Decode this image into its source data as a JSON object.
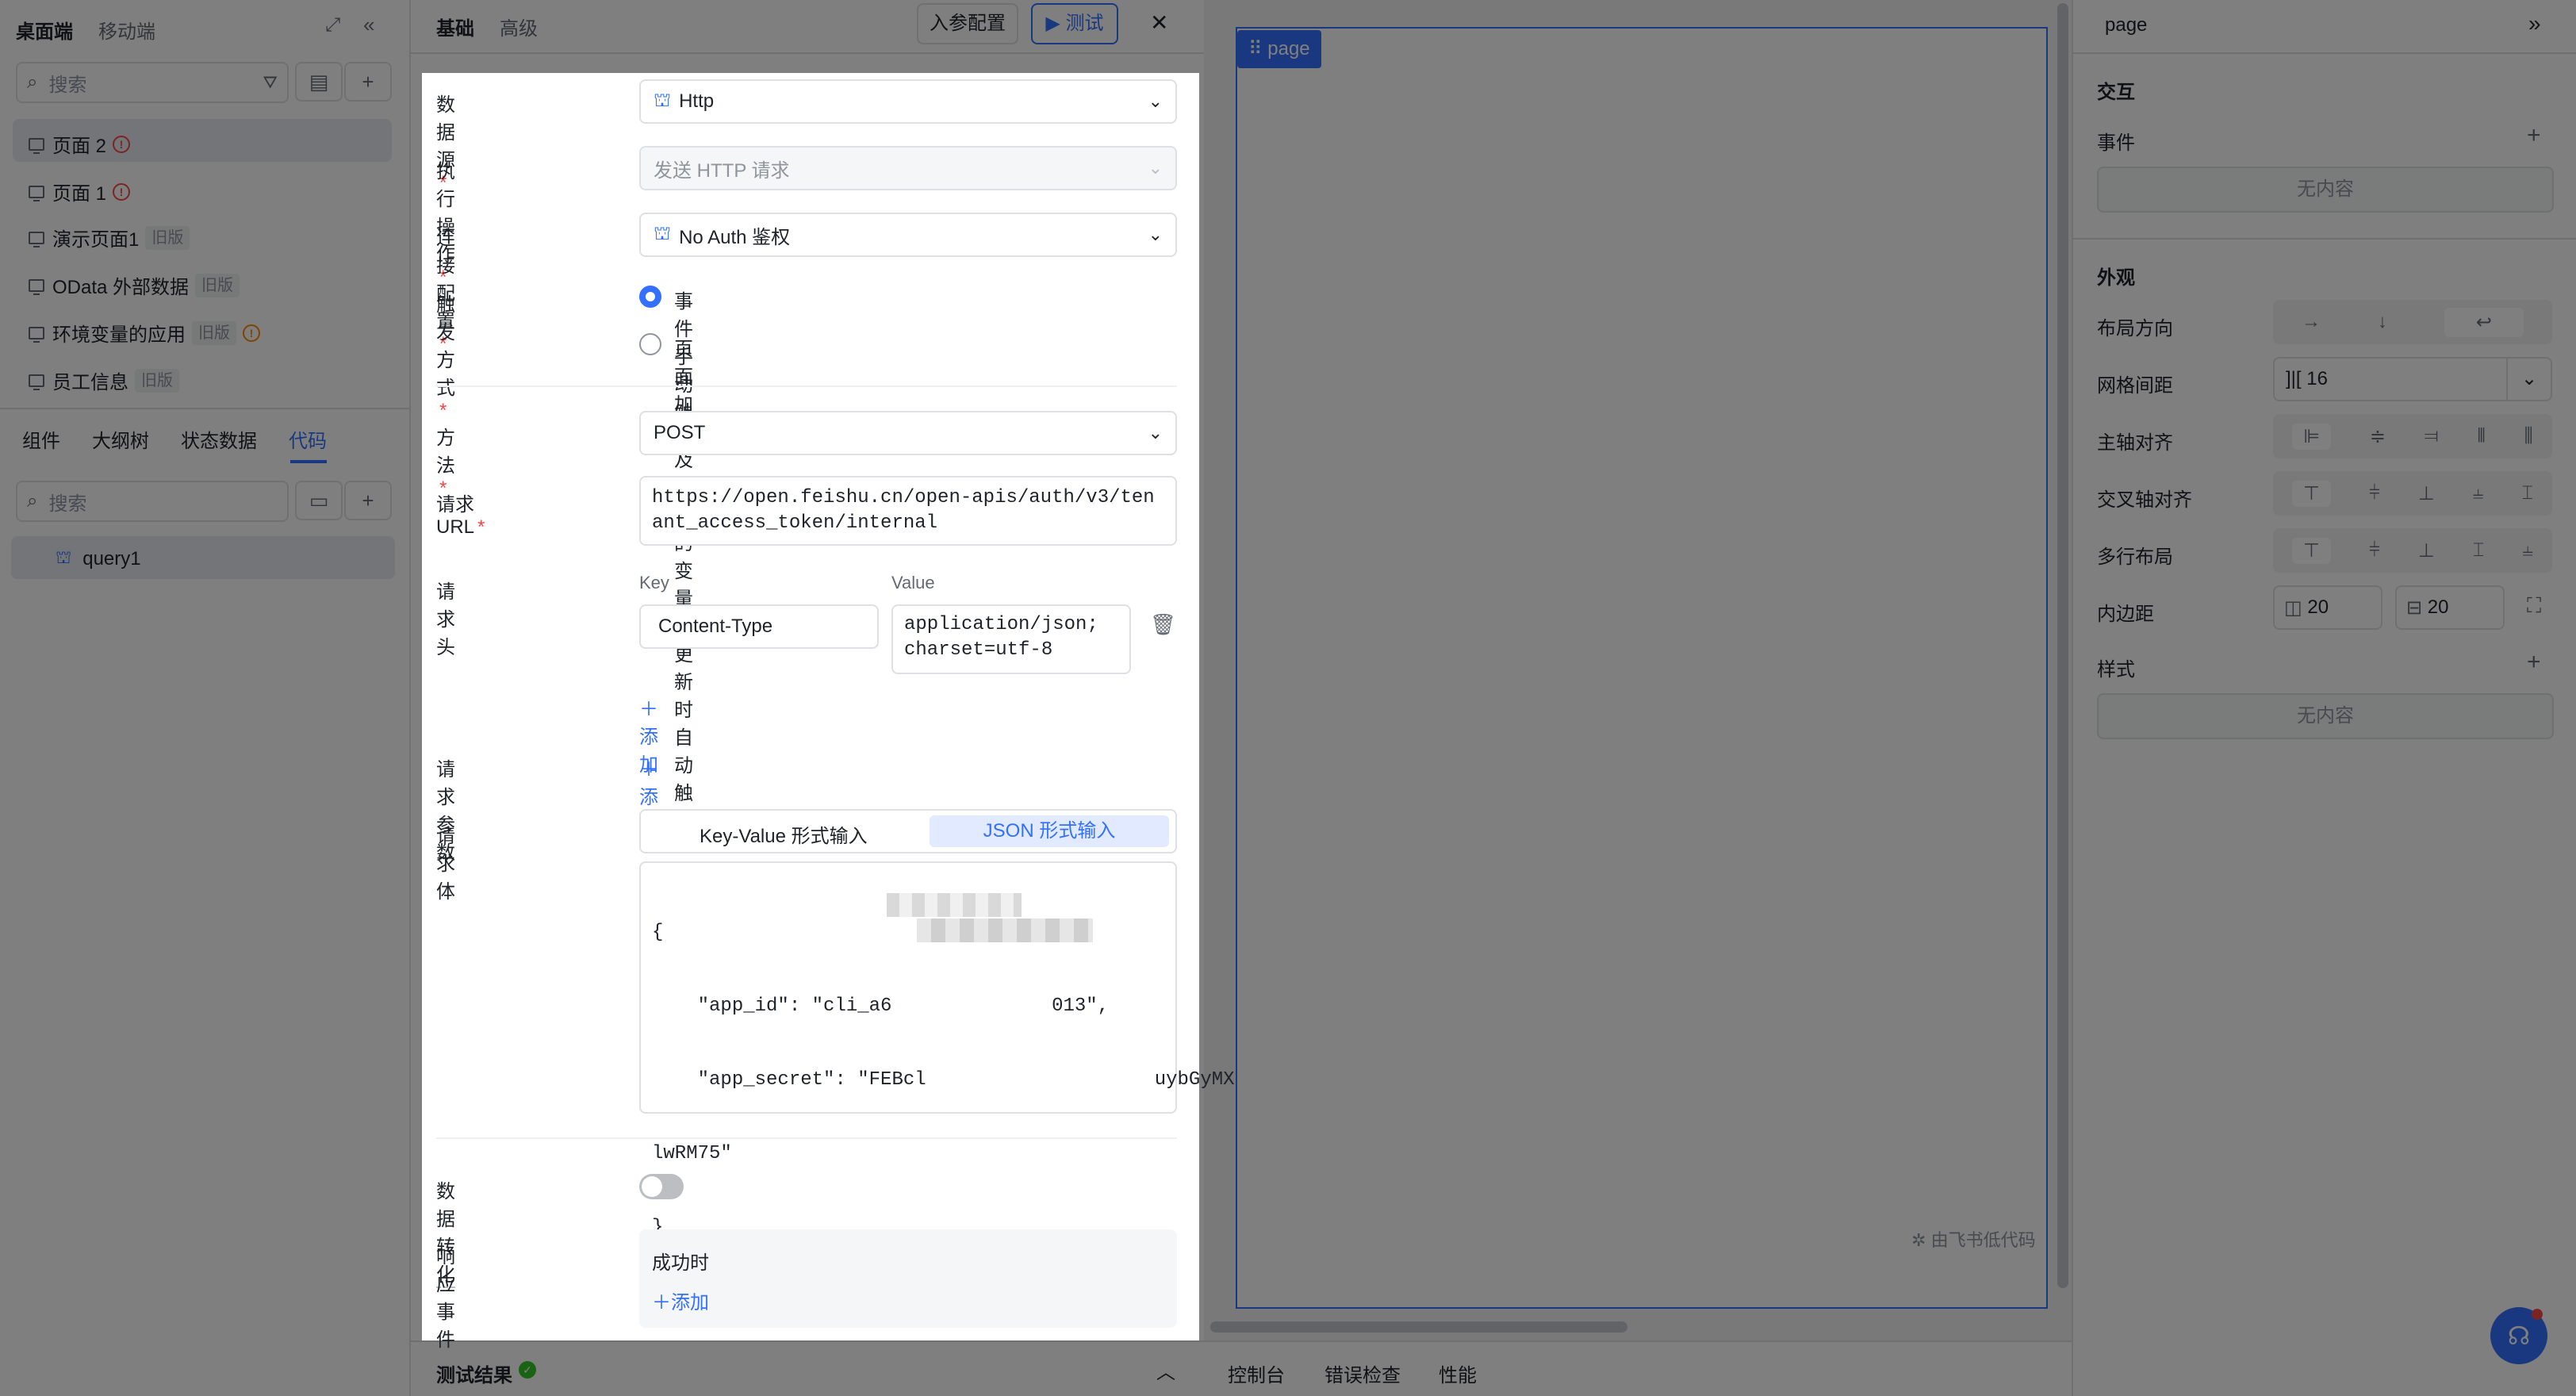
{
  "left_panel": {
    "tabs": [
      "桌面端",
      "移动端"
    ],
    "search_placeholder": "搜索",
    "pages": [
      {
        "label": "页面 2",
        "warn": "!",
        "badge": ""
      },
      {
        "label": "页面 1",
        "warn": "!",
        "badge": ""
      },
      {
        "label": "演示页面1",
        "warn": "",
        "badge": "旧版"
      },
      {
        "label": "OData 外部数据",
        "warn": "",
        "badge": "旧版"
      },
      {
        "label": "环境变量的应用",
        "warn": "!",
        "badge": "旧版"
      },
      {
        "label": "员工信息",
        "warn": "",
        "badge": "旧版"
      }
    ],
    "bottom_tabs": [
      "组件",
      "大纲树",
      "状态数据",
      "代码"
    ],
    "search2_placeholder": "搜索",
    "query_item": "query1"
  },
  "editor": {
    "tabs": [
      "基础",
      "高级"
    ],
    "params_button": "入参配置",
    "test_button": "测试",
    "close": "✕",
    "fields": {
      "datasource_label": "数据源",
      "datasource_value": "Http",
      "operation_label": "执行操作",
      "operation_value": "发送 HTTP 请求",
      "connection_label": "连接配置",
      "connection_value": "No Auth 鉴权",
      "trigger_label": "触发方式",
      "trigger_option1": "事件手动触发",
      "trigger_option2": "页面加载及引用的变量值更新时自动触发",
      "method_label": "方法",
      "method_value": "POST",
      "url_label": "请求 URL",
      "url_value": "https://open.feishu.cn/open-apis/auth/v3/tenant_access_token/internal",
      "headers_label": "请求头",
      "header_key_col": "Key",
      "header_value_col": "Value",
      "header_key": "Content-Type",
      "header_value": "application/json; charset=utf-8",
      "add_header": "添加",
      "params_label": "请求参数",
      "add_param": "添加",
      "body_label": "请求体",
      "body_tab_kv": "Key-Value 形式输入",
      "body_tab_json": "JSON 形式输入",
      "body_lines": [
        "{",
        "    \"app_id\": \"cli_a6              013\",",
        "    \"app_secret\": \"FEBcl                    uybGyMX",
        "lwRM75\"",
        "}"
      ],
      "transform_label": "数据转化",
      "events_label": "响应事件",
      "events_success": "成功时",
      "add_event": "添加"
    },
    "test_result": "测试结果"
  },
  "canvas": {
    "page_tag": "page",
    "watermark": "由飞书低代码",
    "bottom_tabs": [
      "控制台",
      "错误检查",
      "性能"
    ]
  },
  "right_panel": {
    "title": "page",
    "interaction_title": "交互",
    "events_label": "事件",
    "no_content": "无内容",
    "appearance_title": "外观",
    "layout_dir_label": "布局方向",
    "grid_gap_label": "网格间距",
    "grid_gap_value": "16",
    "main_align_label": "主轴对齐",
    "cross_align_label": "交叉轴对齐",
    "multiline_label": "多行布局",
    "padding_label": "内边距",
    "padding_a": "20",
    "padding_b": "20",
    "style_title": "样式",
    "style_empty": "无内容"
  },
  "colors": {
    "accent": "#3370ff",
    "canvas_border": "#3370ff",
    "dim": "rgba(0,0,0,0.5)"
  }
}
